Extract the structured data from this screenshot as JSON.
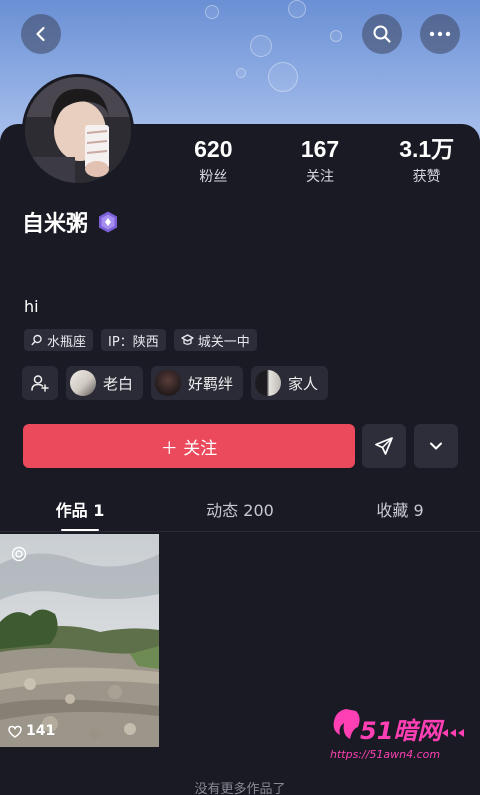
{
  "header": {
    "back_icon": "chevron-left-icon",
    "search_icon": "search-icon",
    "more_icon": "more-icon"
  },
  "profile": {
    "name": "自米粥",
    "bio": "hi",
    "stats": [
      {
        "value": "620",
        "label": "粉丝"
      },
      {
        "value": "167",
        "label": "关注"
      },
      {
        "value": "3.1万",
        "label": "获赞"
      }
    ],
    "tags": [
      {
        "icon": "search-icon",
        "label": "水瓶座"
      },
      {
        "icon": "",
        "label": "IP：陕西"
      },
      {
        "icon": "school-icon",
        "label": "城关一中"
      }
    ],
    "friends": [
      {
        "name": "老白"
      },
      {
        "name": "好羁绊"
      },
      {
        "name": "家人"
      }
    ]
  },
  "actions": {
    "follow_label": "＋ 关注"
  },
  "tabs": [
    {
      "label": "作品 1",
      "active": true
    },
    {
      "label": "动态 200",
      "active": false
    },
    {
      "label": "收藏 9",
      "active": false
    }
  ],
  "posts": [
    {
      "likes": "141"
    }
  ],
  "footer": {
    "text": "没有更多作品了"
  },
  "watermark": {
    "logo": "51暗网",
    "url": "https://51awn4.com"
  },
  "colors": {
    "accent": "#ea4a5c",
    "background": "#191a24"
  }
}
